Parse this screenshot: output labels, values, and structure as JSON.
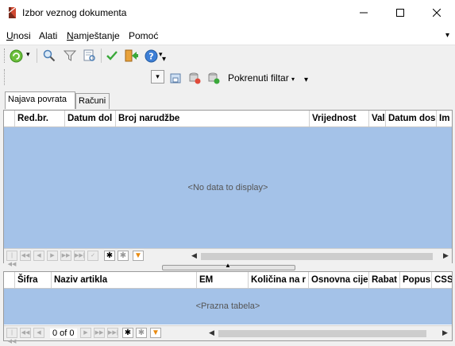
{
  "window": {
    "title": "Izbor veznog dokumenta"
  },
  "menu": {
    "items": [
      {
        "label": "Unosi",
        "u": "U",
        "rest": "nosi"
      },
      {
        "label": "Alati",
        "u": "",
        "rest": "Alati"
      },
      {
        "label": "Namještanje",
        "u": "N",
        "rest": "amještanje"
      },
      {
        "label": "Pomoć",
        "u": "",
        "rest": "Pomoć"
      }
    ]
  },
  "toolbar2": {
    "filter_label": "Pokrenuti filtar"
  },
  "tabs": [
    {
      "label": "Najava povrata",
      "active": true
    },
    {
      "label": "Računi",
      "active": false
    }
  ],
  "grid_top": {
    "columns": [
      "Red.br.",
      "Datum dol",
      "Broj narudžbe",
      "Vrijednost",
      "Val",
      "Datum dos",
      "Im"
    ],
    "empty_text": "<No data to display>"
  },
  "grid_bottom": {
    "columns": [
      "Šifra",
      "Naziv artikla",
      "EM",
      "Količina na r",
      "Osnovna cije",
      "Rabat",
      "Popus",
      "CSS"
    ],
    "empty_text": "<Prazna tabela>",
    "record_text": "0 of 0"
  },
  "colors": {
    "grid_body": "#a4c2e8",
    "accent_green": "#3aa83a"
  }
}
